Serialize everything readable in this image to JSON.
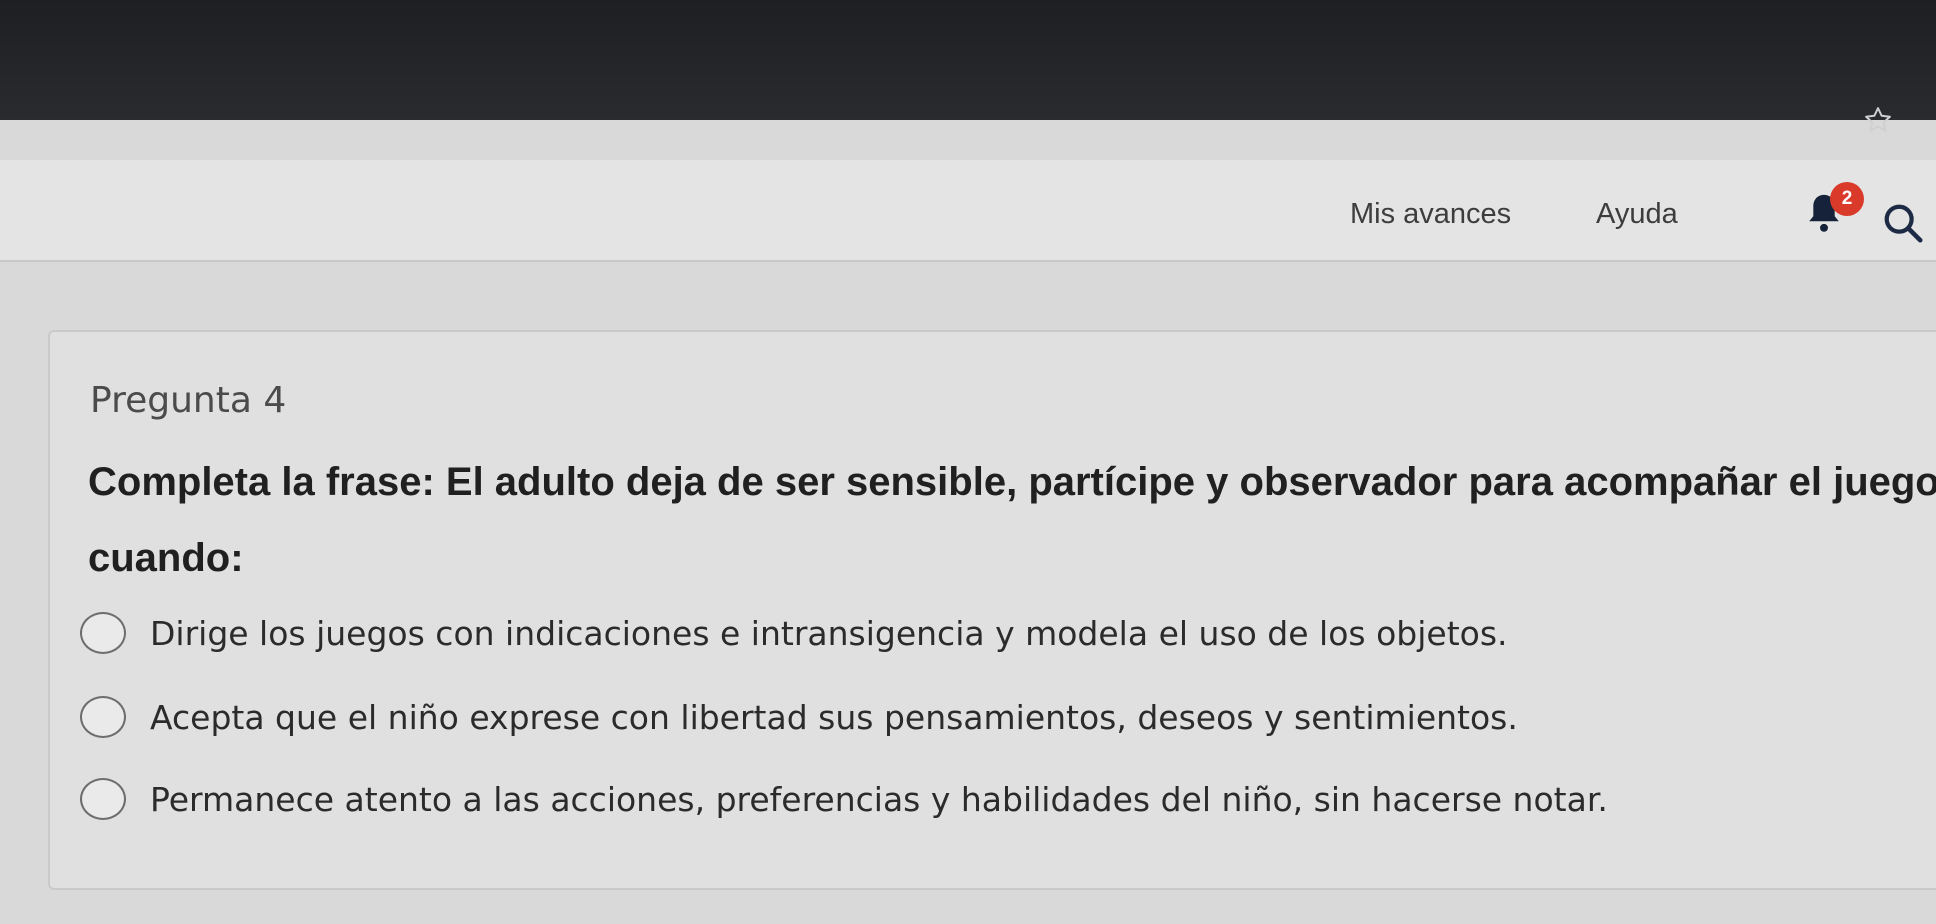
{
  "header": {
    "nav": [
      {
        "label": "Mis avances"
      },
      {
        "label": "Ayuda"
      }
    ],
    "notifications_count": "2"
  },
  "question": {
    "number": "Pregunta 4",
    "text": "Completa la frase: El adulto deja de ser sensible, partícipe y observador para acompañar el juego cuando:",
    "options": [
      {
        "label": "Dirige los juegos con indicaciones e intransigencia y modela el uso de los objetos."
      },
      {
        "label": "Acepta que el niño exprese con libertad sus pensamientos, deseos y sentimientos."
      },
      {
        "label": "Permanece atento a las acciones, preferencias y habilidades del niño, sin hacerse notar."
      }
    ]
  },
  "icons": {
    "star": "star-icon",
    "bell": "bell-icon",
    "search": "search-icon"
  }
}
